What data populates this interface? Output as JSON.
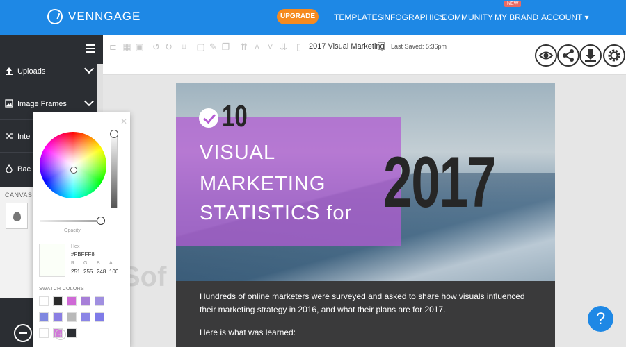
{
  "nav": {
    "brand": "VENNGAGE",
    "upgrade": "UPGRADE",
    "templates": "TEMPLATES",
    "infographics": "INFOGRAPHICS",
    "community": "COMMUNITY",
    "my_brand": "MY BRAND",
    "my_brand_badge": "NEW",
    "account": "ACCOUNT ▾"
  },
  "sidebar": {
    "items": [
      {
        "label": "Uploads",
        "icon": "upload-icon"
      },
      {
        "label": "Image Frames",
        "icon": "image-frame-icon"
      },
      {
        "label": "Inte",
        "icon": "shuffle-icon"
      },
      {
        "label": "Bac",
        "icon": "drop-icon"
      }
    ],
    "canvas_label": "CANVAS"
  },
  "toolbar": {
    "doc_title": "2017 Visual Marketing",
    "last_saved": "Last Saved: 5:36pm"
  },
  "infographic": {
    "number": "10",
    "line1": "VISUAL",
    "line2": "MARKETING",
    "line3": "STATISTICS for",
    "year": "2017",
    "body": "Hundreds of online marketers were surveyed and asked to share how visuals influenced their marketing strategy in 2016, and what their plans are for 2017.",
    "learned": "Here is what was learned:"
  },
  "picker": {
    "opacity_label": "Opacity",
    "hex_label": "Hex",
    "hex_value": "#FBFFF8",
    "channels": [
      {
        "label": "R",
        "value": "251"
      },
      {
        "label": "G",
        "value": "255"
      },
      {
        "label": "B",
        "value": "248"
      },
      {
        "label": "A",
        "value": "100"
      }
    ],
    "swatch_label": "SWATCH COLORS",
    "swatches": [
      "#ffffff",
      "#2b2b2b",
      "#cf6ad6",
      "#a77fd8",
      "#a08fe0",
      "#7f87e0",
      "#8b7fe3",
      "#b9b9b9",
      "#8b85e6",
      "#7f7be8",
      "#ffffff",
      "#d07ad8",
      "#2b2e33"
    ],
    "add_label": "+"
  },
  "help_label": "?",
  "watermark": "Sof"
}
